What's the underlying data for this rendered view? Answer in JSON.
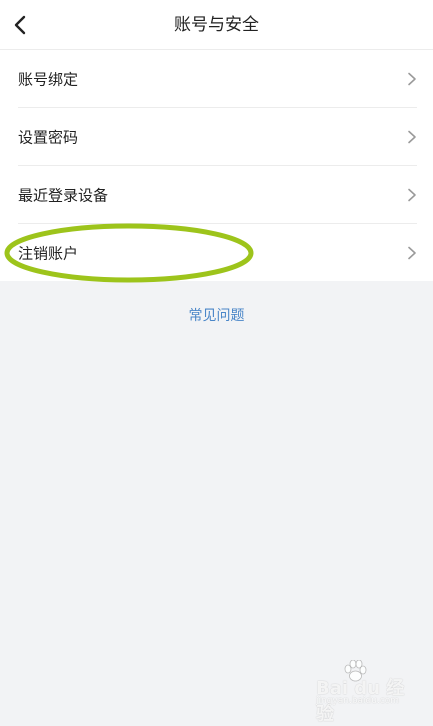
{
  "header": {
    "title": "账号与安全",
    "back_icon": "chevron-left-icon"
  },
  "settings_list": {
    "items": [
      {
        "label": "账号绑定",
        "icon": "chevron-right-icon"
      },
      {
        "label": "设置密码",
        "icon": "chevron-right-icon"
      },
      {
        "label": "最近登录设备",
        "icon": "chevron-right-icon"
      },
      {
        "label": "注销账户",
        "icon": "chevron-right-icon"
      }
    ]
  },
  "faq": {
    "label": "常见问题"
  },
  "annotation": {
    "highlight_color": "#9dc41b"
  },
  "watermark": {
    "text": "Bai du 经验",
    "subtext": "jingyan.baidu.com"
  },
  "colors": {
    "background": "#f2f3f5",
    "surface": "#ffffff",
    "text": "#222222",
    "link": "#4a86c8",
    "chevron": "#9a9a9a",
    "divider": "#ececec"
  }
}
